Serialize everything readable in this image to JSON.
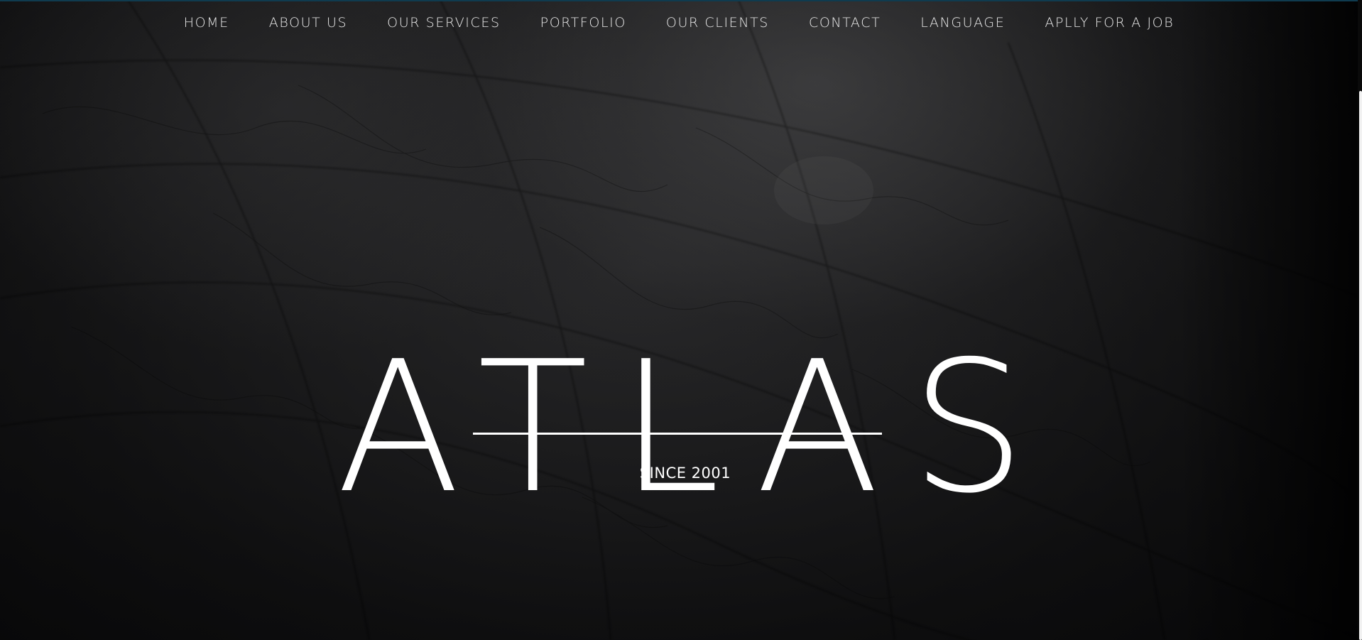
{
  "nav": {
    "items": [
      {
        "label": "HOME"
      },
      {
        "label": "ABOUT US"
      },
      {
        "label": "OUR SERVICES"
      },
      {
        "label": "PORTFOLIO"
      },
      {
        "label": "OUR CLIENTS"
      },
      {
        "label": "CONTACT"
      },
      {
        "label": "LANGUAGE"
      },
      {
        "label": "APLLY FOR A JOB"
      }
    ]
  },
  "hero": {
    "title": "ATLAS",
    "subtitle": "SINCE 2001"
  },
  "colors": {
    "background": "#0b0b0c",
    "text": "#ffffff",
    "top_accent": "#0f3b4f"
  },
  "icons": {
    "background": "globe-map-image"
  }
}
